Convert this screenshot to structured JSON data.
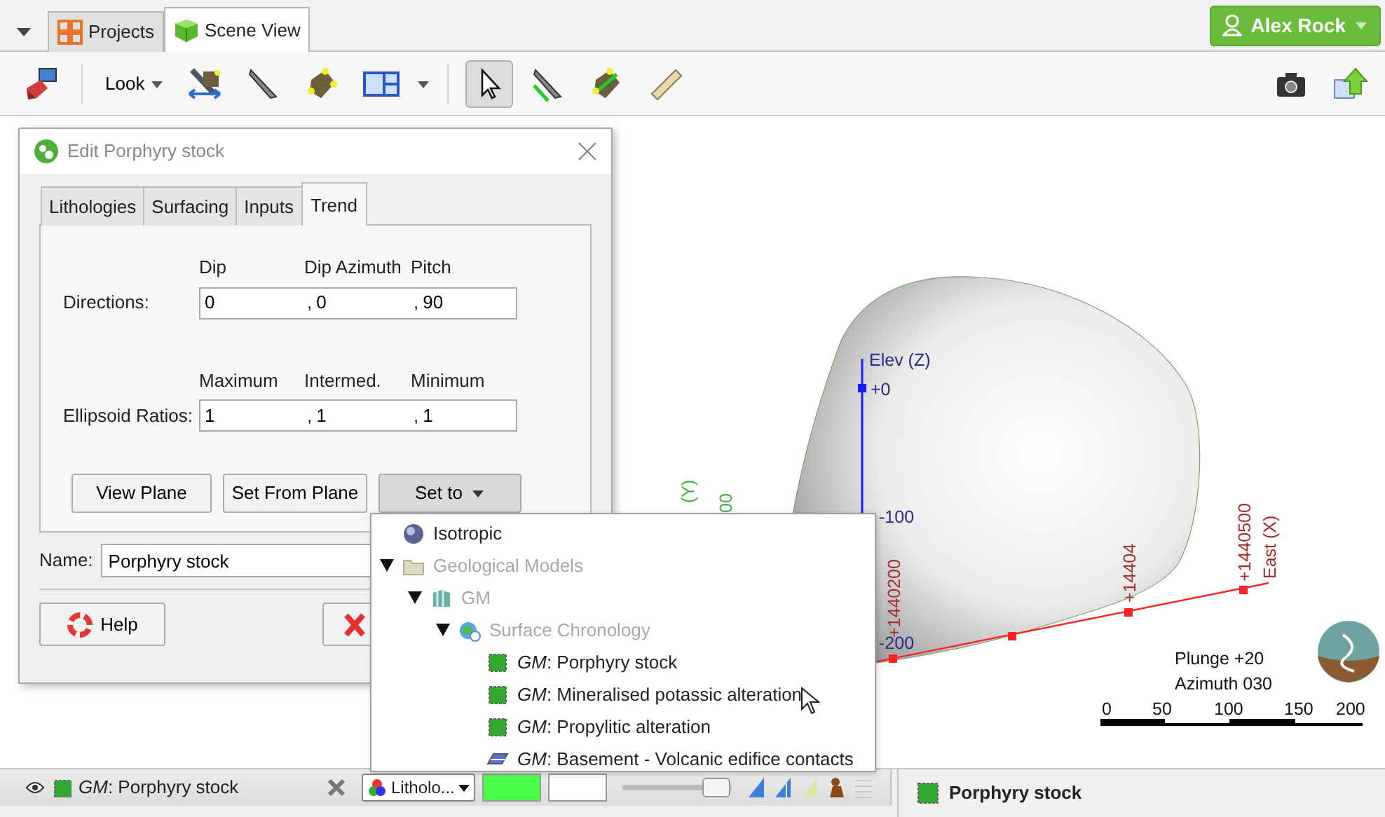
{
  "tab_bar": {
    "tabs": [
      {
        "label": "Projects",
        "kind": "grid",
        "selected": false
      },
      {
        "label": "Scene View",
        "kind": "cube",
        "selected": true
      }
    ],
    "user": {
      "name": "Alex Rock"
    }
  },
  "toolbar": {
    "look": "Look",
    "tools": [
      {
        "kind": "pointer",
        "selected": true
      },
      {
        "kind": "line-slicer",
        "selected": false
      },
      {
        "kind": "plane-slicer",
        "selected": false
      },
      {
        "kind": "ruler",
        "selected": false
      }
    ]
  },
  "dialog": {
    "title": "Edit Porphyry stock",
    "tabs": [
      {
        "label": "Lithologies",
        "selected": false
      },
      {
        "label": "Surfacing",
        "selected": false
      },
      {
        "label": "Inputs",
        "selected": false
      },
      {
        "label": "Trend",
        "selected": true
      }
    ],
    "rows": [
      {
        "label": "Directions:",
        "headers": [
          "Dip",
          "Dip Azimuth",
          "Pitch"
        ],
        "fields": [
          {
            "value": "0"
          },
          {
            "separator": ",",
            "value": "0"
          },
          {
            "separator": ",",
            "value": "90"
          }
        ]
      },
      {
        "label": "Ellipsoid Ratios:",
        "headers": [
          "Maximum",
          "Intermed.",
          "Minimum"
        ],
        "fields": [
          {
            "value": "1"
          },
          {
            "separator": ",",
            "value": "1"
          },
          {
            "separator": ",",
            "value": "1"
          }
        ]
      }
    ],
    "buttons": [
      {
        "label": "View Plane",
        "kind": "plain"
      },
      {
        "label": "Set From Plane",
        "kind": "plain"
      },
      {
        "label": "Set to",
        "kind": "menu",
        "expanded": true
      }
    ],
    "name": {
      "label": "Name:",
      "value": "Porphyry stock"
    },
    "footer": [
      {
        "kind": "help",
        "label": "Help"
      },
      {
        "kind": "cancel"
      }
    ]
  },
  "menu": {
    "items": [
      {
        "label": "Isotropic",
        "kind": "sphere",
        "disabled": false
      },
      {
        "label": "Geological Models",
        "kind": "folder",
        "disabled": true,
        "expanded": true,
        "children": [
          {
            "label": "GM",
            "kind": "model",
            "disabled": true,
            "expanded": true,
            "children": [
              {
                "label": "Surface Chronology",
                "kind": "chronology",
                "disabled": true,
                "expanded": true,
                "children": [
                  {
                    "label": "*GM*: Porphyry stock",
                    "kind": "volume",
                    "disabled": false
                  },
                  {
                    "label": "*GM*: Mineralised potassic alteration",
                    "kind": "volume",
                    "disabled": false
                  },
                  {
                    "label": "*GM*: Propylitic alteration",
                    "kind": "volume",
                    "disabled": false
                  },
                  {
                    "label": "*GM*: Basement - Volcanic edifice contacts",
                    "kind": "surface",
                    "disabled": false
                  }
                ]
              }
            ]
          }
        ]
      }
    ]
  },
  "scene": {
    "z_axis": {
      "title": "Elev (Z)",
      "ticks": [
        "+0",
        "-100",
        "-200"
      ]
    },
    "x_axis": {
      "title": "East (X)",
      "ticks": [
        "+1440200",
        "+14404",
        "+1440500"
      ]
    },
    "y_axis": {
      "title": "(Y)",
      "ticks": [
        "00"
      ]
    },
    "orientation": {
      "plunge": "Plunge +20",
      "azimuth": "Azimuth 030"
    },
    "scale": [
      "0",
      "50",
      "100",
      "150",
      "200"
    ]
  },
  "bottom": {
    "item": "*GM*: Porphyry stock",
    "display": "Litholo...",
    "swatch": {
      "color": "#4dff4d"
    },
    "opacity": {
      "level": 0.85
    },
    "properties": "Porphyry stock"
  }
}
